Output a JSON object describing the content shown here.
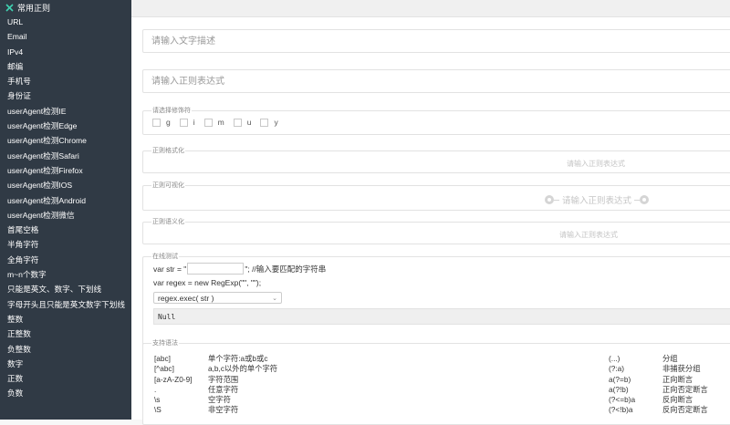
{
  "sidebar": {
    "title": "常用正则",
    "items": [
      "URL",
      "Email",
      "IPv4",
      "邮编",
      "手机号",
      "身份证",
      "userAgent检测IE",
      "userAgent检测Edge",
      "userAgent检测Chrome",
      "userAgent检测Safari",
      "userAgent检测Firefox",
      "userAgent检测IOS",
      "userAgent检测Android",
      "userAgent检测微信",
      "首尾空格",
      "半角字符",
      "全角字符",
      "m~n个数字",
      "只能是英文、数字、下划线",
      "字母开头且只能是英文数字下划线",
      "整数",
      "正整数",
      "负整数",
      "数字",
      "正数",
      "负数"
    ]
  },
  "form": {
    "desc_placeholder": "请输入文字描述",
    "regex_placeholder": "请输入正则表达式"
  },
  "flags": {
    "legend": "请选择修饰符",
    "items": [
      "g",
      "i",
      "m",
      "u",
      "y"
    ]
  },
  "format": {
    "legend": "正则格式化",
    "placeholder": "请输入正则表达式"
  },
  "visual": {
    "legend": "正则可视化",
    "placeholder": "请输入正则表达式"
  },
  "semantic": {
    "legend": "正则语义化",
    "placeholder": "请输入正则表达式"
  },
  "online_test": {
    "legend": "在线测试",
    "line1_prefix": "var str = \"",
    "line1_suffix": "\"; //输入要匹配的字符串",
    "line2": "var regex = new RegExp(\"\", \"\");",
    "select_value": "regex.exec( str )",
    "result": "Null"
  },
  "syntax": {
    "legend": "支持语法",
    "rows": [
      [
        "[abc]",
        "单个字符:a或b或c",
        "(...)",
        "分组"
      ],
      [
        "[^abc]",
        "a,b,c以外的单个字符",
        "(?:a)",
        "非捕获分组"
      ],
      [
        "[a-zA-Z0-9]",
        "字符范围",
        "a(?=b)",
        "正向断言"
      ],
      [
        ".",
        "任意字符",
        "a(?!b)",
        "正向否定断言"
      ],
      [
        "\\s",
        "空字符",
        "(?<=b)a",
        "反向断言"
      ],
      [
        "\\S",
        "非空字符",
        "(?<!b)a",
        "反向否定断言"
      ]
    ]
  }
}
